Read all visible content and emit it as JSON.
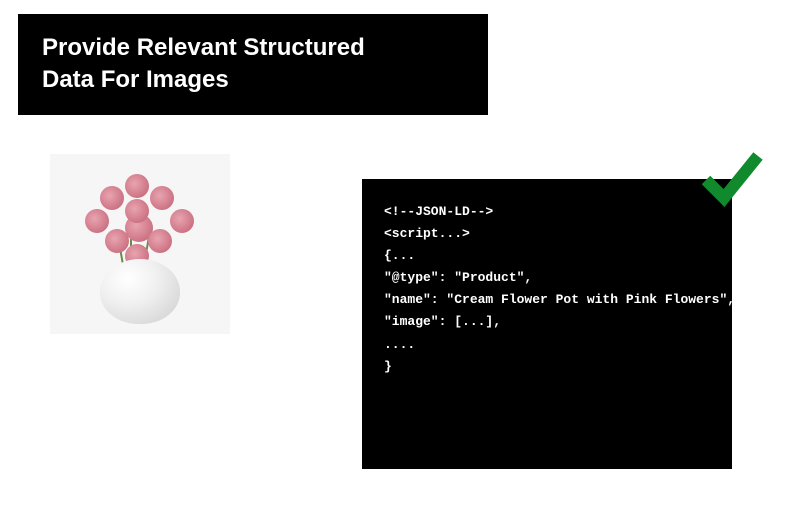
{
  "title": {
    "line1": "Provide Relevant Structured",
    "line2": "Data For Images"
  },
  "image": {
    "alt": "Cream flower pot with pink flowers"
  },
  "code": {
    "line1": "<!--JSON-LD-->",
    "blank1": "",
    "line2": "<script...>",
    "line3": "{...",
    "line4": "\"@type\": \"Product\",",
    "line5": "\"name\": \"Cream Flower Pot with Pink Flowers\",",
    "line6": "\"image\": [...],",
    "line7": "....",
    "line8": "}"
  },
  "checkmark": {
    "color": "#118a2d"
  }
}
